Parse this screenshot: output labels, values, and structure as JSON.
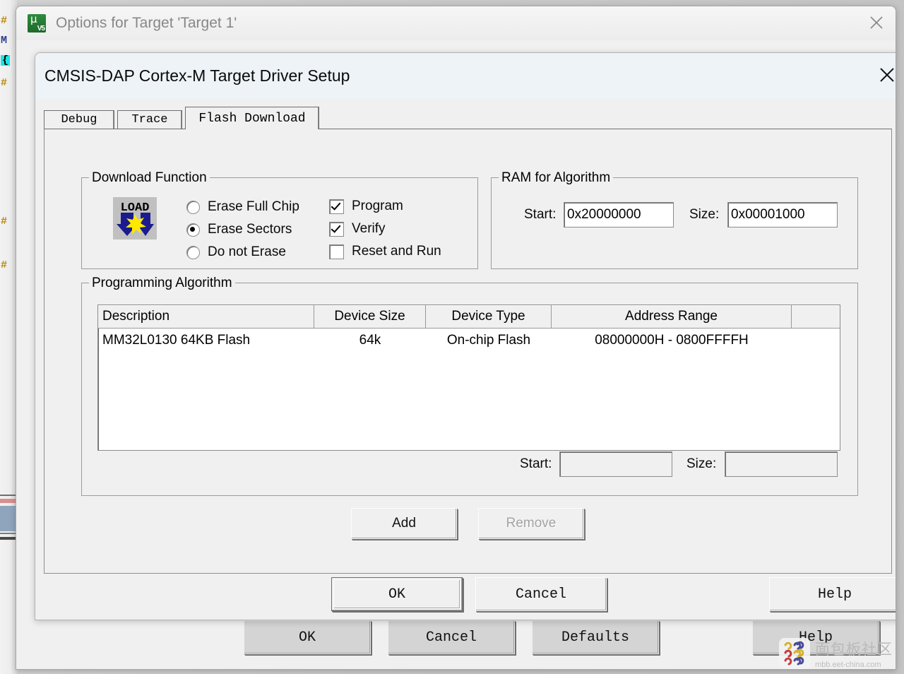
{
  "background": {
    "code_marks": [
      "#",
      "M",
      "{",
      "#",
      "#",
      "#"
    ]
  },
  "outer_dialog": {
    "title": "Options for Target 'Target 1'",
    "icon": "keil-uvision-icon",
    "close_label": "✕",
    "buttons": [
      {
        "label": "OK",
        "name": "outer-ok-button"
      },
      {
        "label": "Cancel",
        "name": "outer-cancel-button"
      },
      {
        "label": "Defaults",
        "name": "outer-defaults-button"
      },
      {
        "label": "Help",
        "name": "outer-help-button"
      }
    ]
  },
  "inner_dialog": {
    "title": "CMSIS-DAP Cortex-M Target Driver Setup",
    "close_label": "✕",
    "tabs": [
      {
        "label": "Debug",
        "selected": false
      },
      {
        "label": "Trace",
        "selected": false
      },
      {
        "label": "Flash Download",
        "selected": true
      }
    ],
    "download_function": {
      "legend": "Download Function",
      "icon": "load-icon",
      "icon_text": "LOAD",
      "radios": [
        {
          "label": "Erase Full Chip",
          "checked": false
        },
        {
          "label": "Erase Sectors",
          "checked": true
        },
        {
          "label": "Do not Erase",
          "checked": false
        }
      ],
      "checkboxes": [
        {
          "label": "Program",
          "checked": true
        },
        {
          "label": "Verify",
          "checked": true
        },
        {
          "label": "Reset and Run",
          "checked": false
        }
      ]
    },
    "ram_for_algorithm": {
      "legend": "RAM for Algorithm",
      "start_label": "Start:",
      "start_value": "0x20000000",
      "size_label": "Size:",
      "size_value": "0x00001000"
    },
    "programming_algorithm": {
      "legend": "Programming Algorithm",
      "columns": [
        "Description",
        "Device Size",
        "Device Type",
        "Address Range",
        ""
      ],
      "rows": [
        {
          "description": "MM32L0130 64KB Flash",
          "device_size": "64k",
          "device_type": "On-chip Flash",
          "address_range": "08000000H - 0800FFFFH"
        }
      ],
      "start_label": "Start:",
      "start_value": "",
      "size_label": "Size:",
      "size_value": "",
      "add_label": "Add",
      "remove_label": "Remove",
      "remove_disabled": true
    },
    "buttons": [
      {
        "label": "OK",
        "name": "inner-ok-button",
        "default": true
      },
      {
        "label": "Cancel",
        "name": "inner-cancel-button",
        "default": false
      },
      {
        "label": "Help",
        "name": "inner-help-button",
        "default": false
      }
    ]
  },
  "watermark": {
    "title": "面包板社区",
    "url": "mbb.eet-china.com"
  }
}
